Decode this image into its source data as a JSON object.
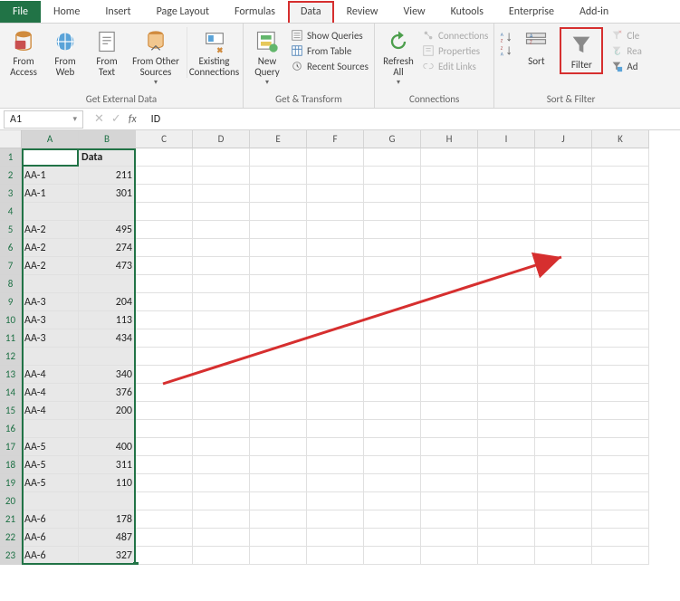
{
  "tabs": {
    "file": "File",
    "items": [
      "Home",
      "Insert",
      "Page Layout",
      "Formulas",
      "Data",
      "Review",
      "View",
      "Kutools",
      "Enterprise",
      "Add-in"
    ],
    "active": "Data"
  },
  "ribbon": {
    "groups": {
      "ext": {
        "label": "Get External Data",
        "buttons": {
          "access": "From\nAccess",
          "web": "From\nWeb",
          "text": "From\nText",
          "other": "From Other\nSources"
        },
        "existing": "Existing\nConnections"
      },
      "transform": {
        "label": "Get & Transform",
        "newquery": "New\nQuery",
        "items": {
          "show": "Show Queries",
          "table": "From Table",
          "recent": "Recent Sources"
        }
      },
      "conn": {
        "label": "Connections",
        "refresh": "Refresh\nAll",
        "items": {
          "connections": "Connections",
          "properties": "Properties",
          "editlinks": "Edit Links"
        }
      },
      "sort": {
        "label": "Sort & Filter",
        "sort": "Sort",
        "filter": "Filter",
        "items": {
          "clear": "Cle",
          "reapply": "Rea",
          "advanced": "Ad"
        }
      }
    }
  },
  "formula_bar": {
    "name": "A1",
    "value": "ID"
  },
  "columns": [
    "A",
    "B",
    "C",
    "D",
    "E",
    "F",
    "G",
    "H",
    "I",
    "J",
    "K"
  ],
  "selected_cols": [
    "A",
    "B"
  ],
  "chart_data": {
    "type": "table",
    "headers": [
      "ID",
      "Data"
    ],
    "rows": [
      {
        "r": 1,
        "id": "ID",
        "data": "Data",
        "hdr": true
      },
      {
        "r": 2,
        "id": "AA-1",
        "data": 211
      },
      {
        "r": 3,
        "id": "AA-1",
        "data": 301
      },
      {
        "r": 4,
        "id": "",
        "data": ""
      },
      {
        "r": 5,
        "id": "AA-2",
        "data": 495
      },
      {
        "r": 6,
        "id": "AA-2",
        "data": 274
      },
      {
        "r": 7,
        "id": "AA-2",
        "data": 473
      },
      {
        "r": 8,
        "id": "",
        "data": ""
      },
      {
        "r": 9,
        "id": "AA-3",
        "data": 204
      },
      {
        "r": 10,
        "id": "AA-3",
        "data": 113
      },
      {
        "r": 11,
        "id": "AA-3",
        "data": 434
      },
      {
        "r": 12,
        "id": "",
        "data": ""
      },
      {
        "r": 13,
        "id": "AA-4",
        "data": 340
      },
      {
        "r": 14,
        "id": "AA-4",
        "data": 376
      },
      {
        "r": 15,
        "id": "AA-4",
        "data": 200
      },
      {
        "r": 16,
        "id": "",
        "data": ""
      },
      {
        "r": 17,
        "id": "AA-5",
        "data": 400
      },
      {
        "r": 18,
        "id": "AA-5",
        "data": 311
      },
      {
        "r": 19,
        "id": "AA-5",
        "data": 110
      },
      {
        "r": 20,
        "id": "",
        "data": ""
      },
      {
        "r": 21,
        "id": "AA-6",
        "data": 178
      },
      {
        "r": 22,
        "id": "AA-6",
        "data": 487
      },
      {
        "r": 23,
        "id": "AA-6",
        "data": 327
      }
    ],
    "selection": "A1:B23"
  }
}
